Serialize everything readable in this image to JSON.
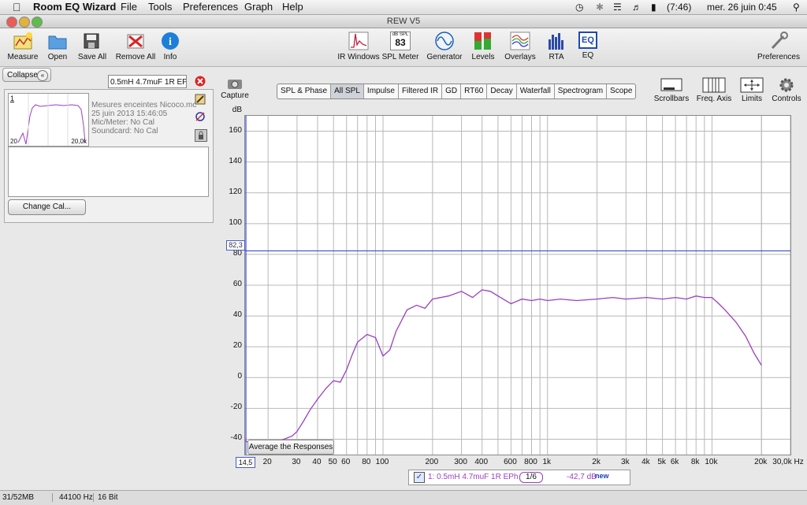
{
  "menubar": {
    "app_name": "Room EQ Wizard",
    "items": [
      "File",
      "Tools",
      "Preferences",
      "Graph",
      "Help"
    ],
    "battery": "(7:46)",
    "datetime": "mer. 26 juin  0:45"
  },
  "window": {
    "title": "REW V5"
  },
  "toolbar": {
    "measure": "Measure",
    "open": "Open",
    "save_all": "Save All",
    "remove_all": "Remove All",
    "info": "Info",
    "ir_windows": "IR Windows",
    "spl_meter": "SPL Meter",
    "spl_caption": "dB SPL",
    "spl_value": "83",
    "generator": "Generator",
    "levels": "Levels",
    "overlays": "Overlays",
    "rta": "RTA",
    "eq": "EQ",
    "eq_icon_text": "EQ",
    "preferences": "Preferences"
  },
  "left_panel": {
    "collapse": "Collapse",
    "measurement_name": "0.5mH 4.7muF 1R EPh",
    "index": "1",
    "thumb_x_min": "20",
    "thumb_x_max": "20,0k",
    "info_lines": [
      "Mesures enceintes Nicoco.mc",
      "25 juin 2013 15:46:05",
      "Mic/Meter: No Cal",
      "Soundcard: No Cal"
    ],
    "change_cal": "Change Cal..."
  },
  "graph_toolbar": {
    "capture": "Capture",
    "tabs": [
      "SPL & Phase",
      "All SPL",
      "Impulse",
      "Filtered IR",
      "GD",
      "RT60",
      "Decay",
      "Waterfall",
      "Spectrogram",
      "Scope"
    ],
    "active_tab": "All SPL",
    "scrollbars": "Scrollbars",
    "freq_axis": "Freq. Axis",
    "limits": "Limits",
    "controls": "Controls"
  },
  "graph": {
    "y_unit": "dB",
    "y_ticks": [
      "160",
      "140",
      "120",
      "100",
      "80",
      "60",
      "40",
      "20",
      "0",
      "-20",
      "-40"
    ],
    "x_ticks": [
      "20",
      "30",
      "40",
      "50",
      "60",
      "80",
      "100",
      "200",
      "300",
      "400",
      "600",
      "800",
      "1k",
      "2k",
      "3k",
      "4k",
      "5k",
      "6k",
      "8k",
      "10k",
      "20k"
    ],
    "x_end_label": "30,0k Hz",
    "x_cursor": "14,5",
    "y_cursor": "82,3",
    "average_button": "Average the Responses"
  },
  "legend": {
    "label": "1: 0.5mH 4.7muF 1R EPh",
    "smoothing": "1/6",
    "level": "-42,7 dB",
    "badge": "new"
  },
  "status": {
    "memory": "31/52MB",
    "sample_rate": "44100 Hz",
    "bit_depth": "16 Bit"
  },
  "chart_data": {
    "type": "line",
    "xlabel": "",
    "ylabel": "dB",
    "x_scale": "log",
    "xlim": [
      14.5,
      30000
    ],
    "ylim": [
      -50,
      170
    ],
    "grid": true,
    "series": [
      {
        "name": "1: 0.5mH 4.7muF 1R EPh",
        "color": "#9b3fc0",
        "x": [
          14.5,
          16,
          18,
          20,
          22,
          25,
          28,
          30,
          33,
          36,
          40,
          45,
          50,
          55,
          60,
          65,
          70,
          80,
          90,
          100,
          110,
          120,
          140,
          160,
          180,
          200,
          250,
          300,
          350,
          400,
          450,
          500,
          600,
          700,
          800,
          900,
          1000,
          1200,
          1500,
          2000,
          2500,
          3000,
          4000,
          5000,
          6000,
          7000,
          8000,
          9000,
          10000,
          11000,
          12000,
          14000,
          16000,
          18000,
          20000
        ],
        "y": [
          -41,
          -43,
          -45,
          -44,
          -42,
          -40,
          -38,
          -35,
          -28,
          -21,
          -14,
          -7,
          -2,
          -3,
          5,
          15,
          23,
          28,
          26,
          14,
          18,
          30,
          44,
          47,
          45,
          51,
          53,
          56,
          52,
          57,
          56,
          53,
          48,
          51,
          50,
          51,
          50,
          51,
          50,
          51,
          52,
          51,
          52,
          51,
          52,
          51,
          53,
          52,
          52,
          48,
          44,
          36,
          27,
          16,
          8
        ]
      }
    ]
  }
}
